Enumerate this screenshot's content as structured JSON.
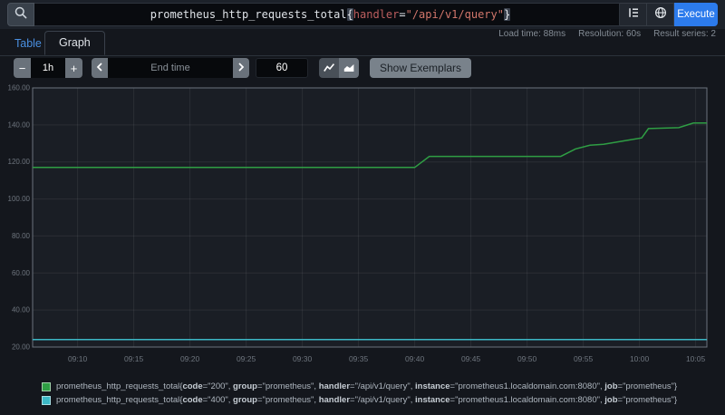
{
  "query": {
    "metric": "prometheus_http_requests_total",
    "brace_open": "{",
    "label_name": "handler",
    "eq": "=",
    "label_value": "\"/api/v1/query\"",
    "brace_close": "}",
    "execute_label": "Execute"
  },
  "tabs": {
    "table_label": "Table",
    "graph_label": "Graph"
  },
  "stats": {
    "load_time": "Load time: 88ms",
    "resolution": "Resolution: 60s",
    "result_series": "Result series: 2"
  },
  "toolbar": {
    "minus_label": "−",
    "plus_label": "+",
    "range_value": "1h",
    "end_time_placeholder": "End time",
    "resolution_value": "60",
    "show_exemplars_label": "Show Exemplars"
  },
  "colors": {
    "execute_blue": "#2c7bec",
    "link_blue": "#4a90e2",
    "series_green": "#2f9e44",
    "series_cyan": "#3cb8c6",
    "promql_label": "#bd5f5f",
    "promql_string": "#d1766b"
  },
  "chart_data": {
    "type": "line",
    "grid": true,
    "legend_position": "bottom",
    "x_domain_minutes": [
      0,
      60
    ],
    "x_ticks": [
      {
        "t": 4,
        "label": "09:10"
      },
      {
        "t": 9,
        "label": "09:15"
      },
      {
        "t": 14,
        "label": "09:20"
      },
      {
        "t": 19,
        "label": "09:25"
      },
      {
        "t": 24,
        "label": "09:30"
      },
      {
        "t": 29,
        "label": "09:35"
      },
      {
        "t": 34,
        "label": "09:40"
      },
      {
        "t": 39,
        "label": "09:45"
      },
      {
        "t": 44,
        "label": "09:50"
      },
      {
        "t": 49,
        "label": "09:55"
      },
      {
        "t": 54,
        "label": "10:00"
      },
      {
        "t": 59,
        "label": "10:05"
      }
    ],
    "y_axis": {
      "min": 20,
      "max": 160,
      "ticks": [
        {
          "value": 160,
          "label": "160.00"
        },
        {
          "value": 140,
          "label": "140.00"
        },
        {
          "value": 120,
          "label": "120.00"
        },
        {
          "value": 100,
          "label": "100.00"
        },
        {
          "value": 80,
          "label": "80.00"
        },
        {
          "value": 60,
          "label": "60.00"
        },
        {
          "value": 40,
          "label": "40.00"
        },
        {
          "value": 20,
          "label": "20.00"
        }
      ]
    },
    "series": [
      {
        "name": "prometheus_http_requests_total code=200",
        "color": "#2f9e44",
        "points": [
          [
            0,
            117
          ],
          [
            34,
            117
          ],
          [
            35.3,
            123
          ],
          [
            47,
            123
          ],
          [
            48.3,
            127
          ],
          [
            49.6,
            129
          ],
          [
            50.8,
            129.5
          ],
          [
            53.2,
            132
          ],
          [
            54.2,
            133
          ],
          [
            54.8,
            138
          ],
          [
            57.5,
            138.5
          ],
          [
            58.8,
            141
          ],
          [
            60,
            141
          ]
        ]
      },
      {
        "name": "prometheus_http_requests_total code=400",
        "color": "#3cb8c6",
        "points": [
          [
            0,
            24
          ],
          [
            60,
            24
          ]
        ]
      }
    ]
  },
  "legend": {
    "entries": [
      {
        "color": "#2f9e44",
        "metric": "prometheus_http_requests_total",
        "labels": [
          [
            "code",
            "200"
          ],
          [
            "group",
            "prometheus"
          ],
          [
            "handler",
            "/api/v1/query"
          ],
          [
            "instance",
            "prometheus1.localdomain.com:8080"
          ],
          [
            "job",
            "prometheus"
          ]
        ]
      },
      {
        "color": "#3cb8c6",
        "metric": "prometheus_http_requests_total",
        "labels": [
          [
            "code",
            "400"
          ],
          [
            "group",
            "prometheus"
          ],
          [
            "handler",
            "/api/v1/query"
          ],
          [
            "instance",
            "prometheus1.localdomain.com:8080"
          ],
          [
            "job",
            "prometheus"
          ]
        ]
      }
    ]
  }
}
